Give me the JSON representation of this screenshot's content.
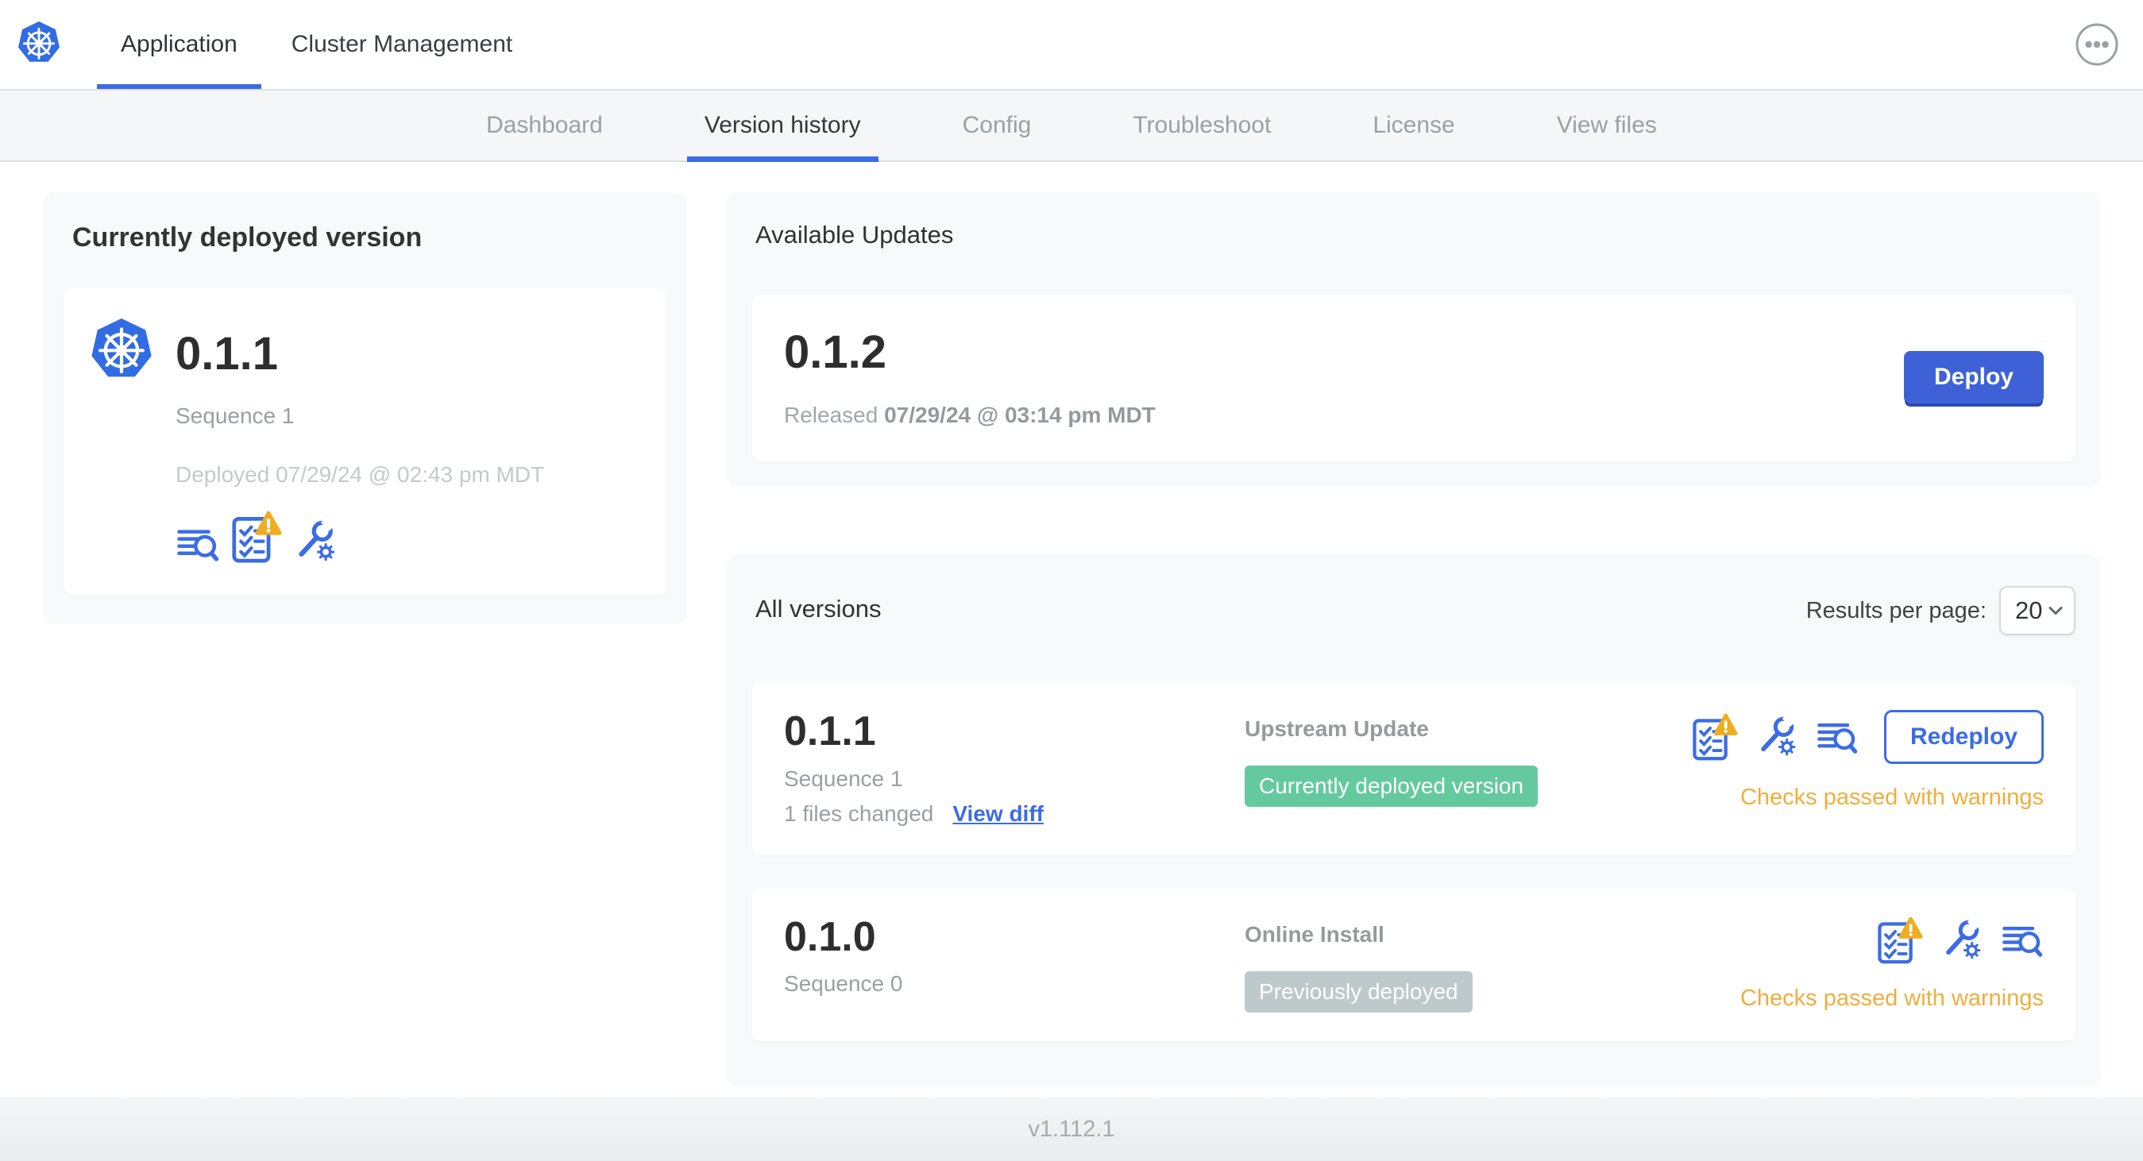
{
  "colors": {
    "primary_blue": "#3b6ce6",
    "kubernetes_blue": "#326CE5",
    "deploy_button_blue": "#3e61d8",
    "green_badge": "#65c9a0",
    "gray_badge": "#bec9cc",
    "warning_amber": "#efad1f",
    "status_amber": "#efae3e",
    "subnav_bg": "#f5f6f8",
    "card_bg": "#f8f9fa"
  },
  "header": {
    "logo_icon": "kubernetes-helm-wheel",
    "tabs": [
      "Application",
      "Cluster Management"
    ],
    "active_tab": "Application",
    "menu_icon": "ellipsis-menu"
  },
  "subnav": {
    "tabs": [
      "Dashboard",
      "Version history",
      "Config",
      "Troubleshoot",
      "License",
      "View files"
    ],
    "active_tab": "Version history"
  },
  "deployed_card": {
    "title": "Currently deployed version",
    "version": "0.1.1",
    "sequence": "Sequence 1",
    "deployed_at": "Deployed 07/29/24 @ 02:43 pm MDT",
    "icons": [
      "release-notes",
      "preflight-checks-warning",
      "edit-config"
    ]
  },
  "available_updates": {
    "title": "Available Updates",
    "version": "0.1.2",
    "released_prefix": "Released",
    "released_date": "07/29/24 @ 03:14 pm MDT",
    "deploy_label": "Deploy"
  },
  "all_versions": {
    "title": "All versions",
    "results_per_page_label": "Results per page:",
    "results_per_page_value": "20",
    "rows": [
      {
        "version": "0.1.1",
        "sequence": "Sequence 1",
        "files_changed": "1 files changed",
        "view_diff_label": "View diff",
        "source": "Upstream Update",
        "badge": "Currently deployed version",
        "badge_style": "green",
        "icons": [
          "preflight-checks-warning",
          "edit-config",
          "release-notes"
        ],
        "action_label": "Redeploy",
        "status": "Checks passed with warnings"
      },
      {
        "version": "0.1.0",
        "sequence": "Sequence 0",
        "source": "Online Install",
        "badge": "Previously deployed",
        "badge_style": "gray",
        "icons": [
          "preflight-checks-warning",
          "edit-config",
          "release-notes"
        ],
        "status": "Checks passed with warnings"
      }
    ]
  },
  "footer": {
    "app_version": "v1.112.1"
  }
}
